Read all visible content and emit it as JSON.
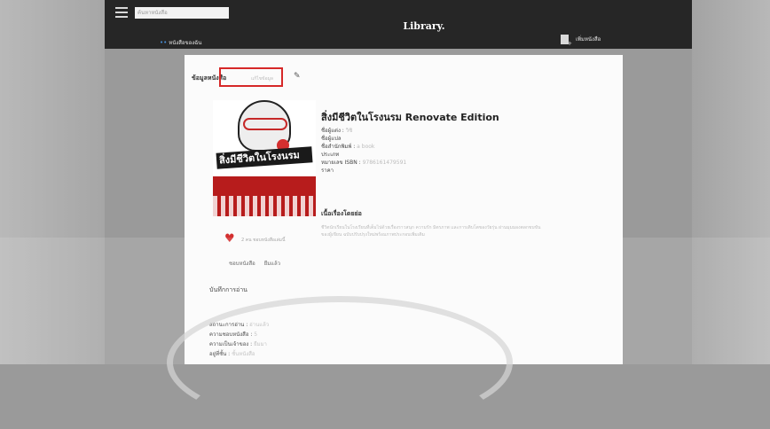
{
  "header": {
    "search_placeholder": "ค้นหาหนังสือ",
    "app_title": "Library.",
    "nav_left": "หนังสือของฉัน",
    "nav_right": "เพิ่มหนังสือ"
  },
  "breadcrumb": {
    "label": "ข้อมูลหนังสือ",
    "sub": "แก้ไขข้อมูล"
  },
  "book": {
    "title": "สิ่งมีชีวิตในโรงนรม Renovate Edition",
    "cover_title": "สิ่งมีชีวิตในโรงนรม",
    "meta": [
      {
        "label": "ชื่อผู้แต่ง :",
        "value": "วิชิ"
      },
      {
        "label": "ชื่อผู้แปล",
        "value": ""
      },
      {
        "label": "ชื่อสำนักพิมพ์ :",
        "value": "a book"
      },
      {
        "label": "ประเภท",
        "value": ""
      },
      {
        "label": "หมายเลข ISBN :",
        "value": "9786161479591"
      },
      {
        "label": "ราคา",
        "value": ""
      }
    ],
    "synopsis_heading": "เนื้อเรื่องโดยย่อ",
    "synopsis": "ชีวิตนักเรียนในโรงเรียนที่เต็มไปด้วยเรื่องราวสนุก ความรัก มิตรภาพ และการเติบโตของวัยรุ่น ผ่านมุมมองตลกขบขันของผู้เขียน ฉบับปรับปรุงใหม่พร้อมภาพประกอบเพิ่มเติม"
  },
  "like": {
    "text": "2 คน ชอบหนังสือเล่มนี้",
    "actions": [
      "ชอบหนังสือ",
      "ยืมแล้ว"
    ]
  },
  "notes": {
    "heading": "บันทึกการอ่าน",
    "details": [
      {
        "label": "สถานะการอ่าน :",
        "value": "อ่านแล้ว"
      },
      {
        "label": "ความชอบหนังสือ :",
        "value": "5"
      },
      {
        "label": "ความเป็นเจ้าของ :",
        "value": "ยืมมา"
      },
      {
        "label": "อยู่ที่ชั้น :",
        "value": "ชั้นหนังสือ"
      }
    ]
  },
  "colors": {
    "header_bg": "#262626",
    "highlight_border": "#d62828",
    "heart": "#d32f2f",
    "accent_blue": "#4a90d9"
  }
}
